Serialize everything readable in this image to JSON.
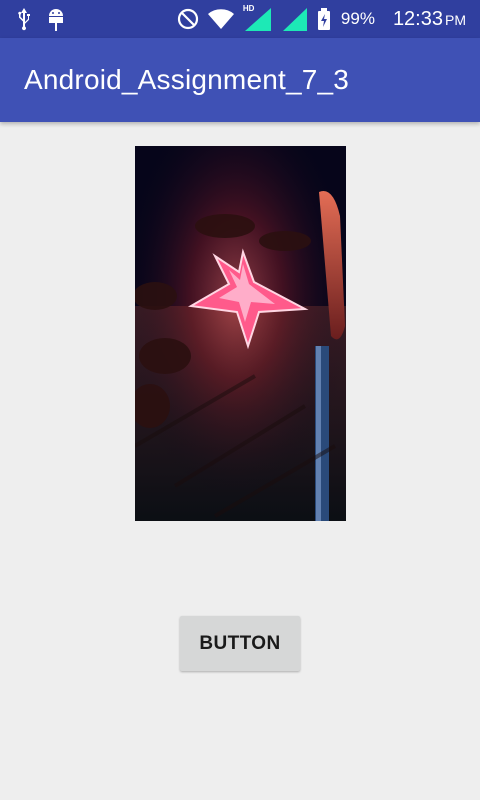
{
  "status_bar": {
    "left_icons": [
      "usb-icon",
      "android-debug-icon"
    ],
    "right_icons": [
      "do-not-disturb-icon",
      "wifi-icon",
      "hd-signal-icon",
      "signal-icon",
      "battery-icon"
    ],
    "hd_label": "HD",
    "battery_percent": "99%",
    "time": "12:33",
    "ampm": "PM"
  },
  "app_bar": {
    "title": "Android_Assignment_7_3",
    "color": "#3f51b5",
    "status_color": "#303f9f"
  },
  "main": {
    "image": {
      "description_icon": "photo-star-lantern-icon"
    },
    "button": {
      "label": "BUTTON"
    }
  }
}
